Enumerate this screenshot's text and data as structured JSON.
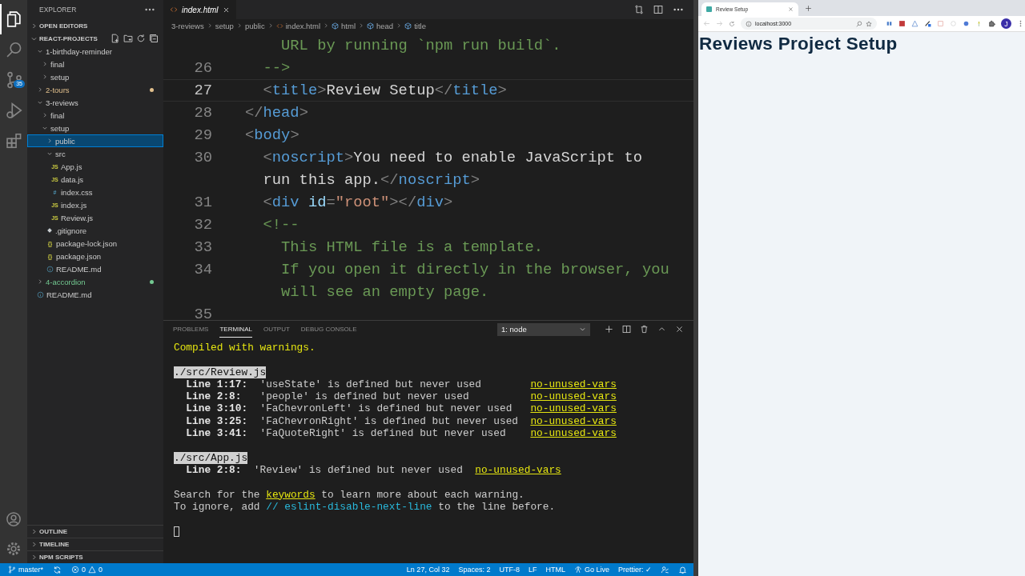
{
  "activity_bar": {
    "items": [
      {
        "kind": "explorer",
        "selected": true
      },
      {
        "kind": "search",
        "selected": false
      },
      {
        "kind": "source-control",
        "selected": false,
        "badge": "35"
      },
      {
        "kind": "run",
        "selected": false
      },
      {
        "kind": "extensions",
        "selected": false
      }
    ]
  },
  "sidebar": {
    "title": "EXPLORER",
    "open_editors": {
      "label": "OPEN EDITORS",
      "expanded": false
    },
    "project": {
      "label": "REACT-PROJECTS",
      "expanded": true
    },
    "tree": [
      {
        "label": "1-birthday-reminder",
        "kind": "folder",
        "expanded": true,
        "selected": false,
        "children": [
          {
            "label": "final",
            "kind": "folder",
            "expanded": false,
            "selected": false
          },
          {
            "label": "setup",
            "kind": "folder",
            "expanded": false,
            "selected": false
          }
        ]
      },
      {
        "label": "2-tours",
        "kind": "folder",
        "expanded": false,
        "selected": false,
        "color": "#e2c08d"
      },
      {
        "label": "3-reviews",
        "kind": "folder",
        "expanded": true,
        "selected": false,
        "children": [
          {
            "label": "final",
            "kind": "folder",
            "expanded": false,
            "selected": false
          },
          {
            "label": "setup",
            "kind": "folder",
            "expanded": true,
            "selected": false,
            "children": [
              {
                "label": "public",
                "kind": "folder",
                "expanded": false,
                "selected": true
              },
              {
                "label": "src",
                "kind": "folder",
                "expanded": true,
                "selected": false,
                "children": [
                  {
                    "label": "App.js",
                    "kind": "js",
                    "icon": "JS",
                    "selected": false
                  },
                  {
                    "label": "data.js",
                    "kind": "js",
                    "icon": "JS",
                    "selected": false
                  },
                  {
                    "label": "index.css",
                    "kind": "css",
                    "icon": "#",
                    "selected": false
                  },
                  {
                    "label": "index.js",
                    "kind": "js",
                    "icon": "JS",
                    "selected": false
                  },
                  {
                    "label": "Review.js",
                    "kind": "js",
                    "icon": "JS",
                    "selected": false
                  }
                ]
              },
              {
                "label": ".gitignore",
                "kind": "git",
                "selected": false
              },
              {
                "label": "package-lock.json",
                "kind": "json",
                "icon": "{}",
                "selected": false
              },
              {
                "label": "package.json",
                "kind": "json",
                "icon": "{}",
                "selected": false
              },
              {
                "label": "README.md",
                "kind": "info",
                "selected": false
              }
            ]
          }
        ]
      },
      {
        "label": "4-accordion",
        "kind": "folder",
        "expanded": false,
        "selected": false,
        "color": "#73c991"
      },
      {
        "label": "README.md",
        "kind": "info",
        "selected": false
      }
    ],
    "bottom_sections": [
      {
        "label": "OUTLINE",
        "expanded": false
      },
      {
        "label": "TIMELINE",
        "expanded": false
      },
      {
        "label": "NPM SCRIPTS",
        "expanded": false
      }
    ]
  },
  "editor": {
    "tabs": [
      {
        "label": "index.html",
        "selected": true
      }
    ],
    "breadcrumbs": [
      {
        "kind": "folder",
        "label": "3-reviews"
      },
      {
        "kind": "folder",
        "label": "setup"
      },
      {
        "kind": "folder",
        "label": "public"
      },
      {
        "kind": "file",
        "label": "index.html"
      },
      {
        "kind": "element",
        "label": "html"
      },
      {
        "kind": "element",
        "label": "head"
      },
      {
        "kind": "element",
        "label": "title"
      }
    ],
    "lines": [
      {
        "current": false,
        "tokens": [
          {
            "kind": "comment",
            "text": "    URL by running `npm run build`."
          }
        ]
      },
      {
        "number": "26",
        "current": false,
        "tokens": [
          {
            "kind": "comment",
            "text": "  -->"
          }
        ]
      },
      {
        "number": "27",
        "current": true,
        "tokens": [
          {
            "kind": "punct",
            "text": "  <"
          },
          {
            "kind": "tag",
            "text": "title"
          },
          {
            "kind": "punct",
            "text": ">"
          },
          {
            "kind": "text",
            "text": "Review Setup"
          },
          {
            "kind": "punct",
            "text": "</"
          },
          {
            "kind": "tag",
            "text": "title"
          },
          {
            "kind": "punct",
            "text": ">"
          }
        ]
      },
      {
        "number": "28",
        "current": false,
        "tokens": [
          {
            "kind": "punct",
            "text": "</"
          },
          {
            "kind": "tag",
            "text": "head"
          },
          {
            "kind": "punct",
            "text": ">"
          }
        ]
      },
      {
        "number": "29",
        "current": false,
        "tokens": [
          {
            "kind": "punct",
            "text": "<"
          },
          {
            "kind": "tag",
            "text": "body"
          },
          {
            "kind": "punct",
            "text": ">"
          }
        ]
      },
      {
        "number": "30",
        "current": false,
        "tokens": [
          {
            "kind": "punct",
            "text": "  <"
          },
          {
            "kind": "tag",
            "text": "noscript"
          },
          {
            "kind": "punct",
            "text": ">"
          },
          {
            "kind": "text",
            "text": "You need to enable JavaScript to"
          }
        ]
      },
      {
        "current": false,
        "tokens": [
          {
            "kind": "text",
            "text": "  run this app."
          },
          {
            "kind": "punct",
            "text": "</"
          },
          {
            "kind": "tag",
            "text": "noscript"
          },
          {
            "kind": "punct",
            "text": ">"
          }
        ]
      },
      {
        "number": "31",
        "current": false,
        "tokens": [
          {
            "kind": "punct",
            "text": "  <"
          },
          {
            "kind": "tag",
            "text": "div"
          },
          {
            "kind": "attr",
            "text": " id"
          },
          {
            "kind": "punct",
            "text": "="
          },
          {
            "kind": "string",
            "text": "\"root\""
          },
          {
            "kind": "punct",
            "text": "></"
          },
          {
            "kind": "tag",
            "text": "div"
          },
          {
            "kind": "punct",
            "text": ">"
          }
        ]
      },
      {
        "number": "32",
        "current": false,
        "tokens": [
          {
            "kind": "comment",
            "text": "  <!--"
          }
        ]
      },
      {
        "number": "33",
        "current": false,
        "tokens": [
          {
            "kind": "comment",
            "text": "    This HTML file is a template."
          }
        ]
      },
      {
        "number": "34",
        "current": false,
        "tokens": [
          {
            "kind": "comment",
            "text": "    If you open it directly in the browser, you"
          }
        ]
      },
      {
        "current": false,
        "tokens": [
          {
            "kind": "comment",
            "text": "    will see an empty page."
          }
        ]
      },
      {
        "number": "35",
        "current": false
      }
    ]
  },
  "panel": {
    "tabs": [
      {
        "label": "PROBLEMS",
        "selected": false
      },
      {
        "label": "TERMINAL",
        "selected": true
      },
      {
        "label": "OUTPUT",
        "selected": false
      },
      {
        "label": "DEBUG CONSOLE",
        "selected": false
      }
    ],
    "terminal_select": "1: node",
    "lines": [
      {
        "kind": "status",
        "text": "Compiled with warnings."
      },
      {
        "kind": "blank"
      },
      {
        "kind": "file",
        "text": "./src/Review.js"
      },
      {
        "kind": "warnings",
        "rows": [
          {
            "location": "Line 1:17:",
            "message": "'useState' is defined but never used",
            "rule": "no-unused-vars"
          },
          {
            "location": "Line 2:8:",
            "message": "'people' is defined but never used",
            "rule": "no-unused-vars"
          },
          {
            "location": "Line 3:10:",
            "message": "'FaChevronLeft' is defined but never used",
            "rule": "no-unused-vars"
          },
          {
            "location": "Line 3:25:",
            "message": "'FaChevronRight' is defined but never used",
            "rule": "no-unused-vars"
          },
          {
            "location": "Line 3:41:",
            "message": "'FaQuoteRight' is defined but never used",
            "rule": "no-unused-vars"
          }
        ]
      },
      {
        "kind": "blank"
      },
      {
        "kind": "file",
        "text": "./src/App.js"
      },
      {
        "kind": "warnings",
        "rows": [
          {
            "location": "Line 2:8:",
            "message": "'Review' is defined but never used",
            "rule": "no-unused-vars"
          }
        ]
      },
      {
        "kind": "blank"
      },
      {
        "kind": "text",
        "parts": [
          {
            "kind": "plain",
            "text": "Search for the "
          },
          {
            "kind": "link",
            "text": "keywords"
          },
          {
            "kind": "plain",
            "text": " to learn more about each warning."
          }
        ]
      },
      {
        "kind": "text",
        "parts": [
          {
            "kind": "plain",
            "text": "To ignore, add "
          },
          {
            "kind": "code",
            "text": "// eslint-disable-next-line"
          },
          {
            "kind": "plain",
            "text": " to the line before."
          }
        ]
      },
      {
        "kind": "blank"
      },
      {
        "kind": "cursor"
      }
    ]
  },
  "status_bar": {
    "left": [
      {
        "kind": "branch",
        "text": "master*"
      },
      {
        "kind": "sync"
      },
      {
        "kind": "problems",
        "errors": "0",
        "warnings": "0"
      }
    ],
    "right": [
      {
        "kind": "text",
        "text": "Ln 27, Col 32"
      },
      {
        "kind": "text",
        "text": "Spaces: 2"
      },
      {
        "kind": "text",
        "text": "UTF-8"
      },
      {
        "kind": "text",
        "text": "LF"
      },
      {
        "kind": "text",
        "text": "HTML"
      },
      {
        "kind": "golive",
        "text": "Go Live"
      },
      {
        "kind": "text",
        "text": "Prettier: ✓"
      },
      {
        "kind": "feedback"
      },
      {
        "kind": "bell"
      }
    ]
  },
  "browser": {
    "tab": {
      "title": "Review Setup",
      "selected": true
    },
    "url": "localhost:3000",
    "profile_initial": "J",
    "page": {
      "heading": "Reviews Project Setup"
    }
  }
}
